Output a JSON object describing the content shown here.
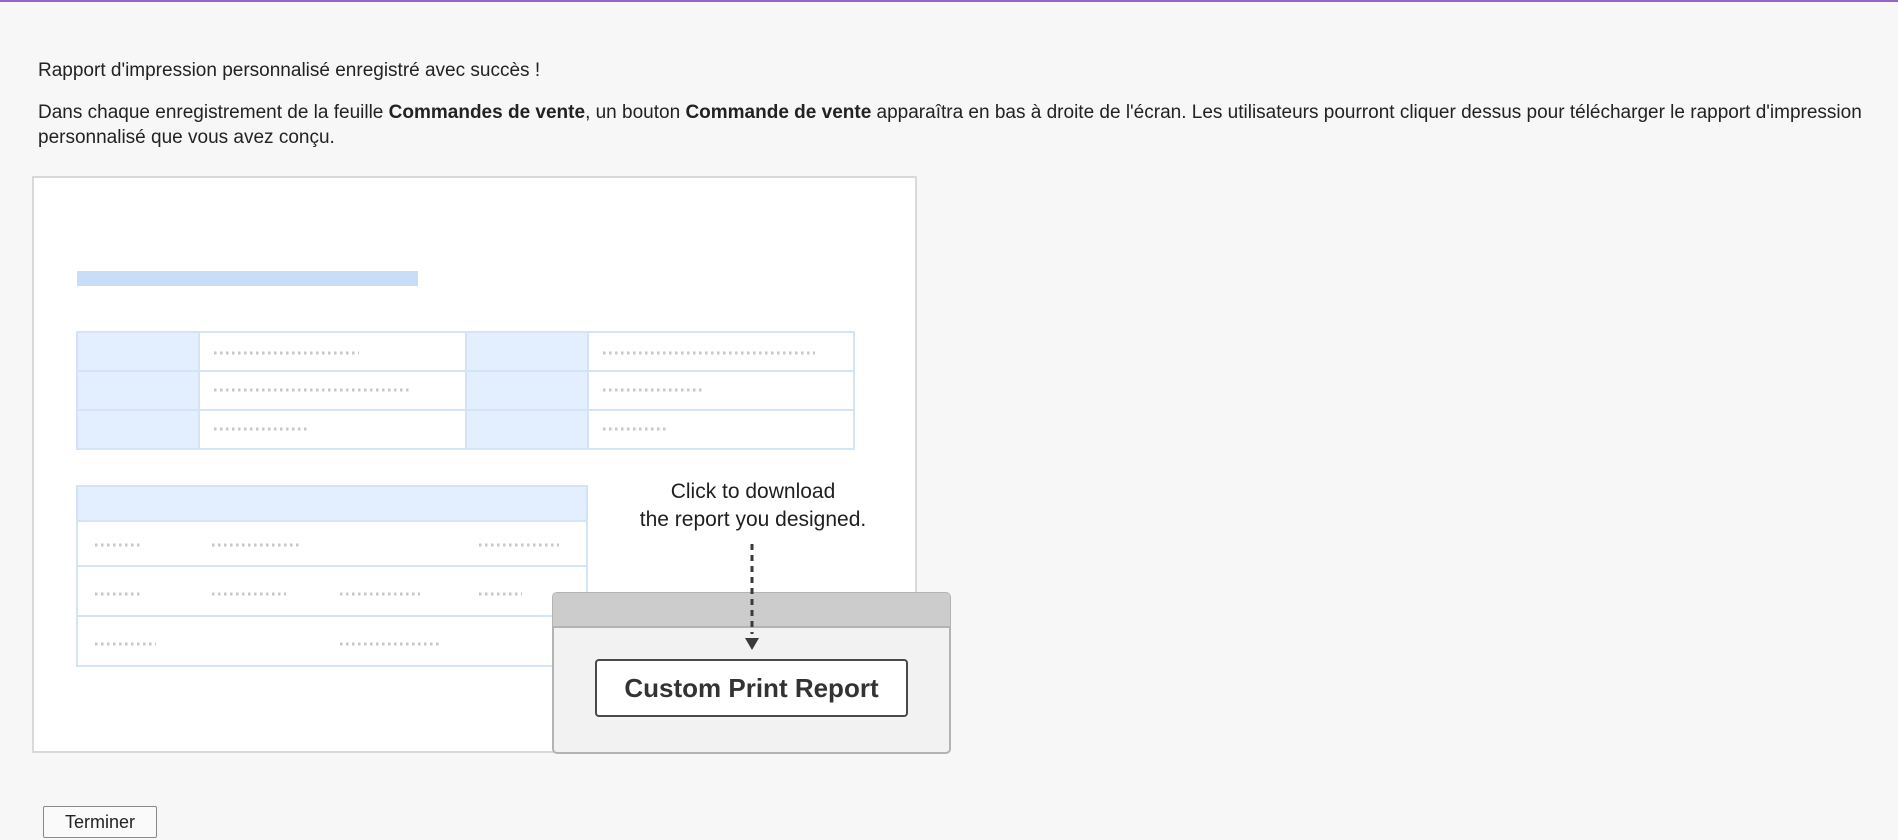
{
  "page": {
    "success_message": "Rapport d'impression personnalisé enregistré avec succès !",
    "description": {
      "part1": "Dans chaque enregistrement de la feuille ",
      "sheet_name": "Commandes de vente",
      "part2": ", un bouton ",
      "button_name": "Commande de vente",
      "part3": " apparaîtra en bas à droite de l'écran. Les utilisateurs pourront cliquer dessus pour télécharger le rapport d'impression personnalisé que vous avez conçu."
    }
  },
  "illustration": {
    "callout_line1": "Click to download",
    "callout_line2": "the report you designed.",
    "button_label": "Custom Print Report"
  },
  "footer": {
    "finish_label": "Terminer"
  },
  "colors": {
    "accent": "#9a63c9",
    "preview_blue": "#c8ddf8",
    "preview_cell": "#e3efff"
  }
}
